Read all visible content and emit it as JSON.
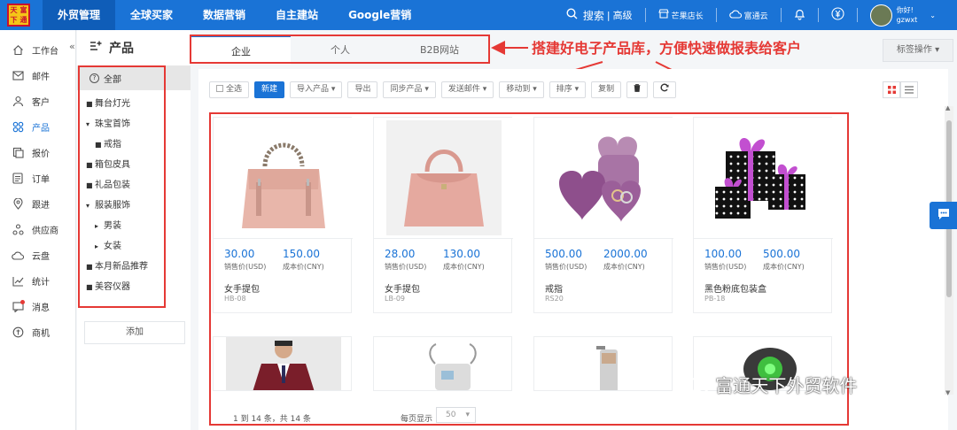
{
  "top": {
    "logo_chars": [
      "天",
      "富",
      "下",
      "通"
    ],
    "nav": [
      "外贸管理",
      "全球买家",
      "数据营销",
      "自主建站",
      "Google营销"
    ],
    "search_label": "搜索",
    "advanced_label": "高级",
    "shop_label": "芒果店长",
    "cloud_label": "富通云",
    "greeting": "你好!",
    "username": "gzwxt"
  },
  "sidebar": {
    "items": [
      "工作台",
      "邮件",
      "客户",
      "产品",
      "报价",
      "订单",
      "跟进",
      "供应商",
      "云盘",
      "统计",
      "消息",
      "商机"
    ]
  },
  "category": {
    "title": "产品",
    "all_label": "全部",
    "items": [
      {
        "label": "舞台灯光",
        "marker": "■"
      },
      {
        "label": "珠宝首饰",
        "marker": "▾"
      },
      {
        "label": "戒指",
        "marker": "■"
      },
      {
        "label": "箱包皮具",
        "marker": "■"
      },
      {
        "label": "礼品包装",
        "marker": "■"
      },
      {
        "label": "服装服饰",
        "marker": "▾"
      },
      {
        "label": "男装",
        "marker": "▸"
      },
      {
        "label": "女装",
        "marker": "▸"
      },
      {
        "label": "本月新品推荐",
        "marker": "■"
      },
      {
        "label": "美容仪器",
        "marker": "■"
      }
    ],
    "add_label": "添加"
  },
  "tabs": [
    "企业",
    "个人",
    "B2B网站"
  ],
  "annotation": "搭建好电子产品库，方便快速做报表给客户",
  "tag_op": "标签操作",
  "toolbar": {
    "select_all": "全选",
    "new": "新建",
    "import": "导入产品",
    "export": "导出",
    "sync": "同步产品",
    "send_mail": "发送邮件",
    "move_to": "移动到",
    "sort": "排序",
    "copy": "复制"
  },
  "products": [
    {
      "price": "30.00",
      "cost": "150.00",
      "price_label": "销售价(USD)",
      "cost_label": "成本价(CNY)",
      "name": "女手提包",
      "code": "HB-08"
    },
    {
      "price": "28.00",
      "cost": "130.00",
      "price_label": "销售价(USD)",
      "cost_label": "成本价(CNY)",
      "name": "女手提包",
      "code": "LB-09"
    },
    {
      "price": "500.00",
      "cost": "2000.00",
      "price_label": "销售价(USD)",
      "cost_label": "成本价(CNY)",
      "name": "戒指",
      "code": "RS20"
    },
    {
      "price": "100.00",
      "cost": "500.00",
      "price_label": "销售价(USD)",
      "cost_label": "成本价(CNY)",
      "name": "黑色粉底包装盒",
      "code": "PB-18"
    }
  ],
  "pager": {
    "summary": "1 到 14 条，共 14 条",
    "per_page_label": "每页显示",
    "per_page": "50"
  },
  "watermark": "富通天下外贸软件"
}
